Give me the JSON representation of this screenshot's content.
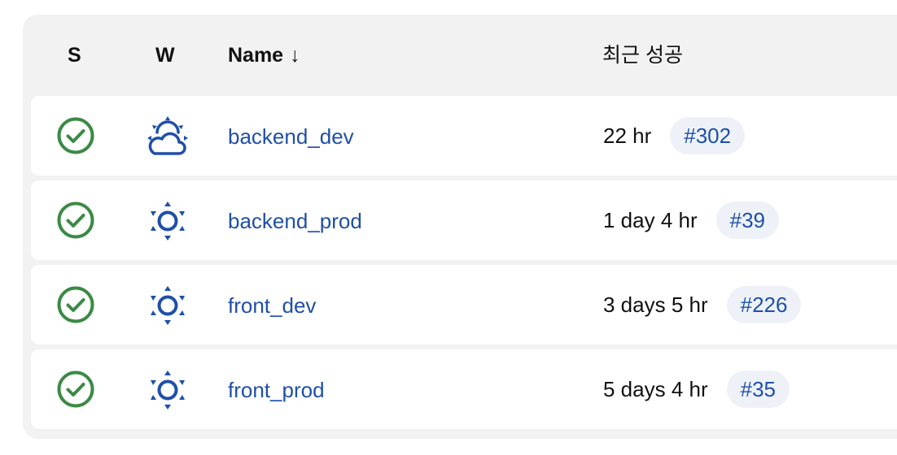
{
  "header": {
    "col_s": "S",
    "col_w": "W",
    "col_name": "Name",
    "sort_indicator": "↓",
    "col_last_success": "최근 성공"
  },
  "jobs": [
    {
      "status_icon": "success-check-icon",
      "weather_icon": "partly-cloudy-icon",
      "name": "backend_dev",
      "last_success_duration": "22 hr",
      "last_success_build": "#302"
    },
    {
      "status_icon": "success-check-icon",
      "weather_icon": "sunny-icon",
      "name": "backend_prod",
      "last_success_duration": "1 day 4 hr",
      "last_success_build": "#39"
    },
    {
      "status_icon": "success-check-icon",
      "weather_icon": "sunny-icon",
      "name": "front_dev",
      "last_success_duration": "3 days 5 hr",
      "last_success_build": "#226"
    },
    {
      "status_icon": "success-check-icon",
      "weather_icon": "sunny-icon",
      "name": "front_prod",
      "last_success_duration": "5 days 4 hr",
      "last_success_build": "#35"
    }
  ],
  "colors": {
    "success_green": "#3a8a45",
    "link_blue": "#1f4fa8",
    "badge_bg": "#eef2f8",
    "panel_bg": "#f2f2f2"
  }
}
